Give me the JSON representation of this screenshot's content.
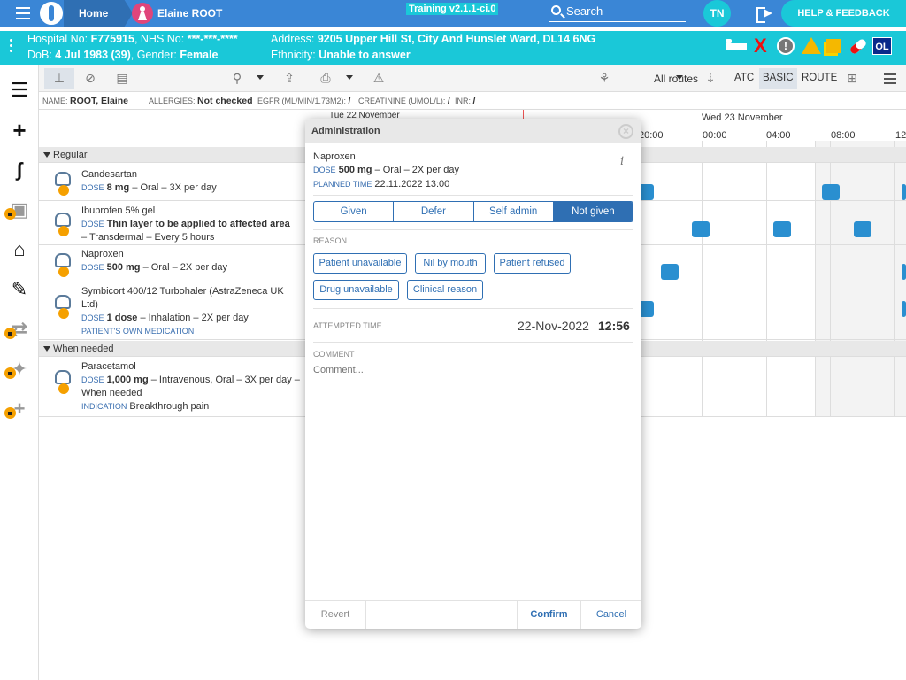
{
  "topbar": {
    "home_label": "Home",
    "patient_name": "Elaine ROOT",
    "training_badge": "Training v2.1.1-ci.0",
    "search_label": "Search",
    "user_initials": "TN",
    "help_label": "HELP & FEEDBACK"
  },
  "banner": {
    "hospital_label": "Hospital No:",
    "hospital_no": "F775915",
    "nhs_label": "NHS No:",
    "nhs_no": "***-***-****",
    "dob_label": "DoB:",
    "dob": "4 Jul 1983 (39)",
    "gender_label": "Gender:",
    "gender": "Female",
    "address_label": "Address:",
    "address": "9205 Upper Hill St, City And Hunslet Ward, DL14 6NG",
    "ethnicity_label": "Ethnicity:",
    "ethnicity": "Unable to answer",
    "ol_badge": "OL"
  },
  "toolbar": {
    "routes_label": "All routes",
    "atc_label": "ATC",
    "basic_label": "BASIC",
    "route_label": "ROUTE"
  },
  "infobar": {
    "name_label": "NAME:",
    "name": "ROOT, Elaine",
    "allergies_label": "ALLERGIES:",
    "allergies": "Not checked",
    "egfr_label": "EGFR (ML/MIN/1.73M2):",
    "egfr": "/",
    "creat_label": "CREATININE (UMOL/L):",
    "creat": "/",
    "inr_label": "INR:",
    "inr": "/"
  },
  "chart": {
    "prev_date": "Tue 22 November",
    "date_header": "Wed 23 November",
    "ticks": [
      "20:00",
      "00:00",
      "04:00",
      "08:00",
      "12"
    ],
    "sections": [
      "Regular",
      "When needed"
    ],
    "rows": [
      {
        "name": "Candesartan",
        "dose_label": "DOSE",
        "dose": "8 mg",
        "detail": "– Oral – 3X per day"
      },
      {
        "name": "Ibuprofen 5% gel",
        "dose_label": "DOSE",
        "dose": "Thin layer to be applied to affected area",
        "detail": "– Transdermal – Every 5 hours"
      },
      {
        "name": "Naproxen",
        "dose_label": "DOSE",
        "dose": "500 mg",
        "detail": "– Oral – 2X per day"
      },
      {
        "name": "Symbicort 400/12 Turbohaler (AstraZeneca UK Ltd)",
        "dose_label": "DOSE",
        "dose": "1 dose",
        "detail": "– Inhalation – 2X per day",
        "extra": "PATIENT'S OWN MEDICATION"
      },
      {
        "name": "Paracetamol",
        "dose_label": "DOSE",
        "dose": "1,000 mg",
        "detail": "– Intravenous, Oral – 3X per day – When needed",
        "extra_label": "INDICATION",
        "extra": "Breakthrough pain"
      }
    ]
  },
  "modal": {
    "title": "Administration",
    "drug": "Naproxen",
    "dose_label": "DOSE",
    "dose": "500 mg",
    "dose_detail": "– Oral – 2X per day",
    "planned_label": "PLANNED TIME",
    "planned_time": "22.11.2022 13:00",
    "segments": [
      "Given",
      "Defer",
      "Self admin",
      "Not given"
    ],
    "reason_label": "REASON",
    "reasons": [
      "Patient unavailable",
      "Nil by mouth",
      "Patient refused",
      "Drug unavailable",
      "Clinical reason"
    ],
    "attempted_label": "ATTEMPTED TIME",
    "attempted_date": "22-Nov-2022",
    "attempted_time": "12:56",
    "comment_label": "COMMENT",
    "comment_placeholder": "Comment...",
    "revert_label": "Revert",
    "confirm_label": "Confirm",
    "cancel_label": "Cancel"
  },
  "colors": {
    "topbar": "#3a86d6",
    "banner": "#1ac8d8",
    "accent": "#2f6fb3",
    "dose_block": "#2a8fd0",
    "lock": "#f5a000"
  }
}
